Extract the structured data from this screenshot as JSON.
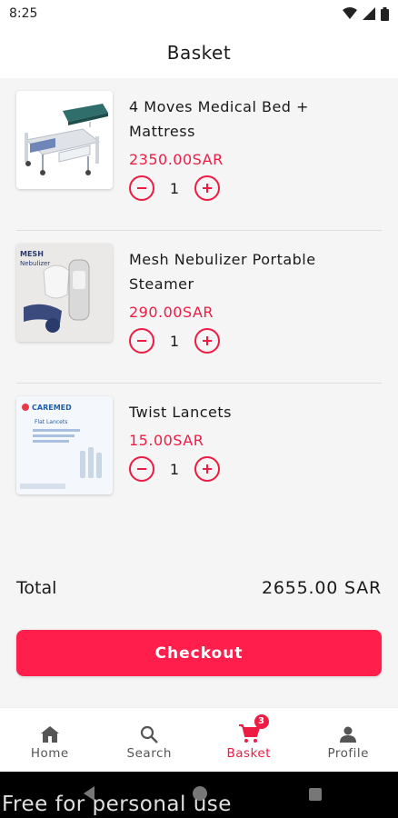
{
  "status_bar": {
    "time": "8:25"
  },
  "header": {
    "title": "Basket"
  },
  "items": [
    {
      "name_line1": "4 Moves Medical Bed +",
      "name_line2": "Mattress",
      "price": "2350.00SAR",
      "quantity": "1"
    },
    {
      "name_line1": "Mesh Nebulizer Portable",
      "name_line2": "Steamer",
      "price": "290.00SAR",
      "quantity": "1",
      "image_text_1": "MESH",
      "image_text_2": "Nebulizer"
    },
    {
      "name_line1": "Twist Lancets",
      "price": "15.00SAR",
      "quantity": "1",
      "image_text_1": "CAREMED",
      "image_text_2": "Flat Lancets"
    }
  ],
  "summary": {
    "total_label": "Total",
    "total_value": "2655.00 SAR"
  },
  "checkout_label": "Checkout",
  "bottom_nav": [
    {
      "label": "Home",
      "icon": "home-icon"
    },
    {
      "label": "Search",
      "icon": "search-icon"
    },
    {
      "label": "Basket",
      "icon": "cart-icon",
      "badge": "3",
      "active": true
    },
    {
      "label": "Profile",
      "icon": "person-icon"
    }
  ],
  "watermark": "Free for personal use",
  "colors": {
    "accent": "#ee1c44",
    "button": "#ff1e4c",
    "background": "#f5f5f5"
  }
}
